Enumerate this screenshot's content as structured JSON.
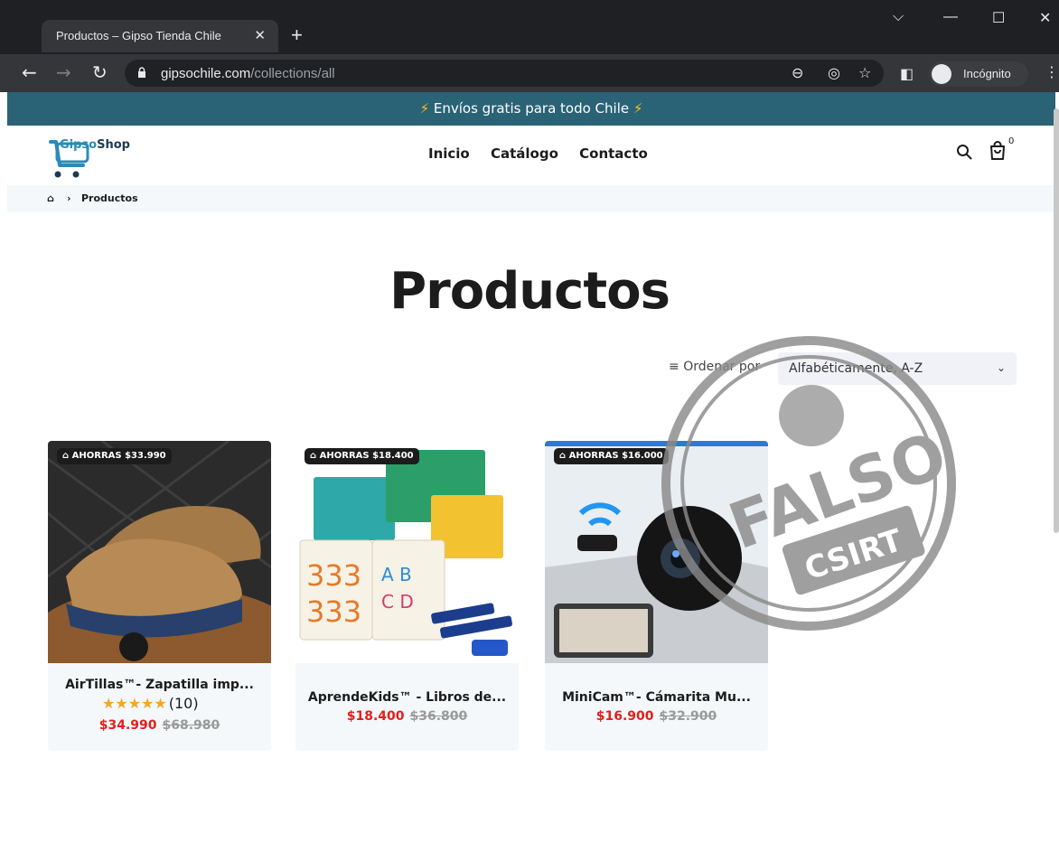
{
  "browser": {
    "tab_title": "Productos – Gipso Tienda Chile",
    "tab_close": "✕",
    "new_tab": "+",
    "url_host": "gipsochile.com",
    "url_path": "/collections/all",
    "incognito_label": "Incógnito"
  },
  "site": {
    "announcement": "Envíos gratis para todo Chile",
    "logo": {
      "gipso": "Gipso",
      "shop": "Shop"
    },
    "nav": [
      "Inicio",
      "Catálogo",
      "Contacto"
    ],
    "cart_count": "0",
    "breadcrumb": {
      "separator": "›",
      "current": "Productos"
    },
    "page_title": "Productos",
    "sort": {
      "label": "Ordenar por",
      "value": "Alfabéticamente, A-Z"
    },
    "products": [
      {
        "badge": "AHORRAS $33.990",
        "name": "AirTillas™- Zapatilla imp...",
        "rating": 5,
        "reviews": "(10)",
        "price": "$34.990",
        "compare_price": "$68.980"
      },
      {
        "badge": "AHORRAS $18.400",
        "name": "AprendeKids™ - Libros de...",
        "price": "$18.400",
        "compare_price": "$36.800"
      },
      {
        "badge": "AHORRAS $16.000",
        "name": "MiniCam™- Cámarita Mu...",
        "price": "$16.900",
        "compare_price": "$32.900"
      }
    ],
    "stamp": {
      "main": "FALSO",
      "sub": "CSIRT"
    }
  },
  "colors": {
    "announcement_bg": "#2a6276",
    "price_red": "#e0201c",
    "card_bg": "#f4f8fb",
    "stamp_gray": "#8a8a8a"
  },
  "icons": [
    "back-icon",
    "forward-icon",
    "reload-icon",
    "lock-icon",
    "zoom-icon",
    "eye-off-icon",
    "star-icon",
    "sidebar-icon",
    "incognito-icon",
    "search-icon",
    "cart-icon",
    "home-icon",
    "sort-icon",
    "chevron-down-icon",
    "tag-icon"
  ]
}
